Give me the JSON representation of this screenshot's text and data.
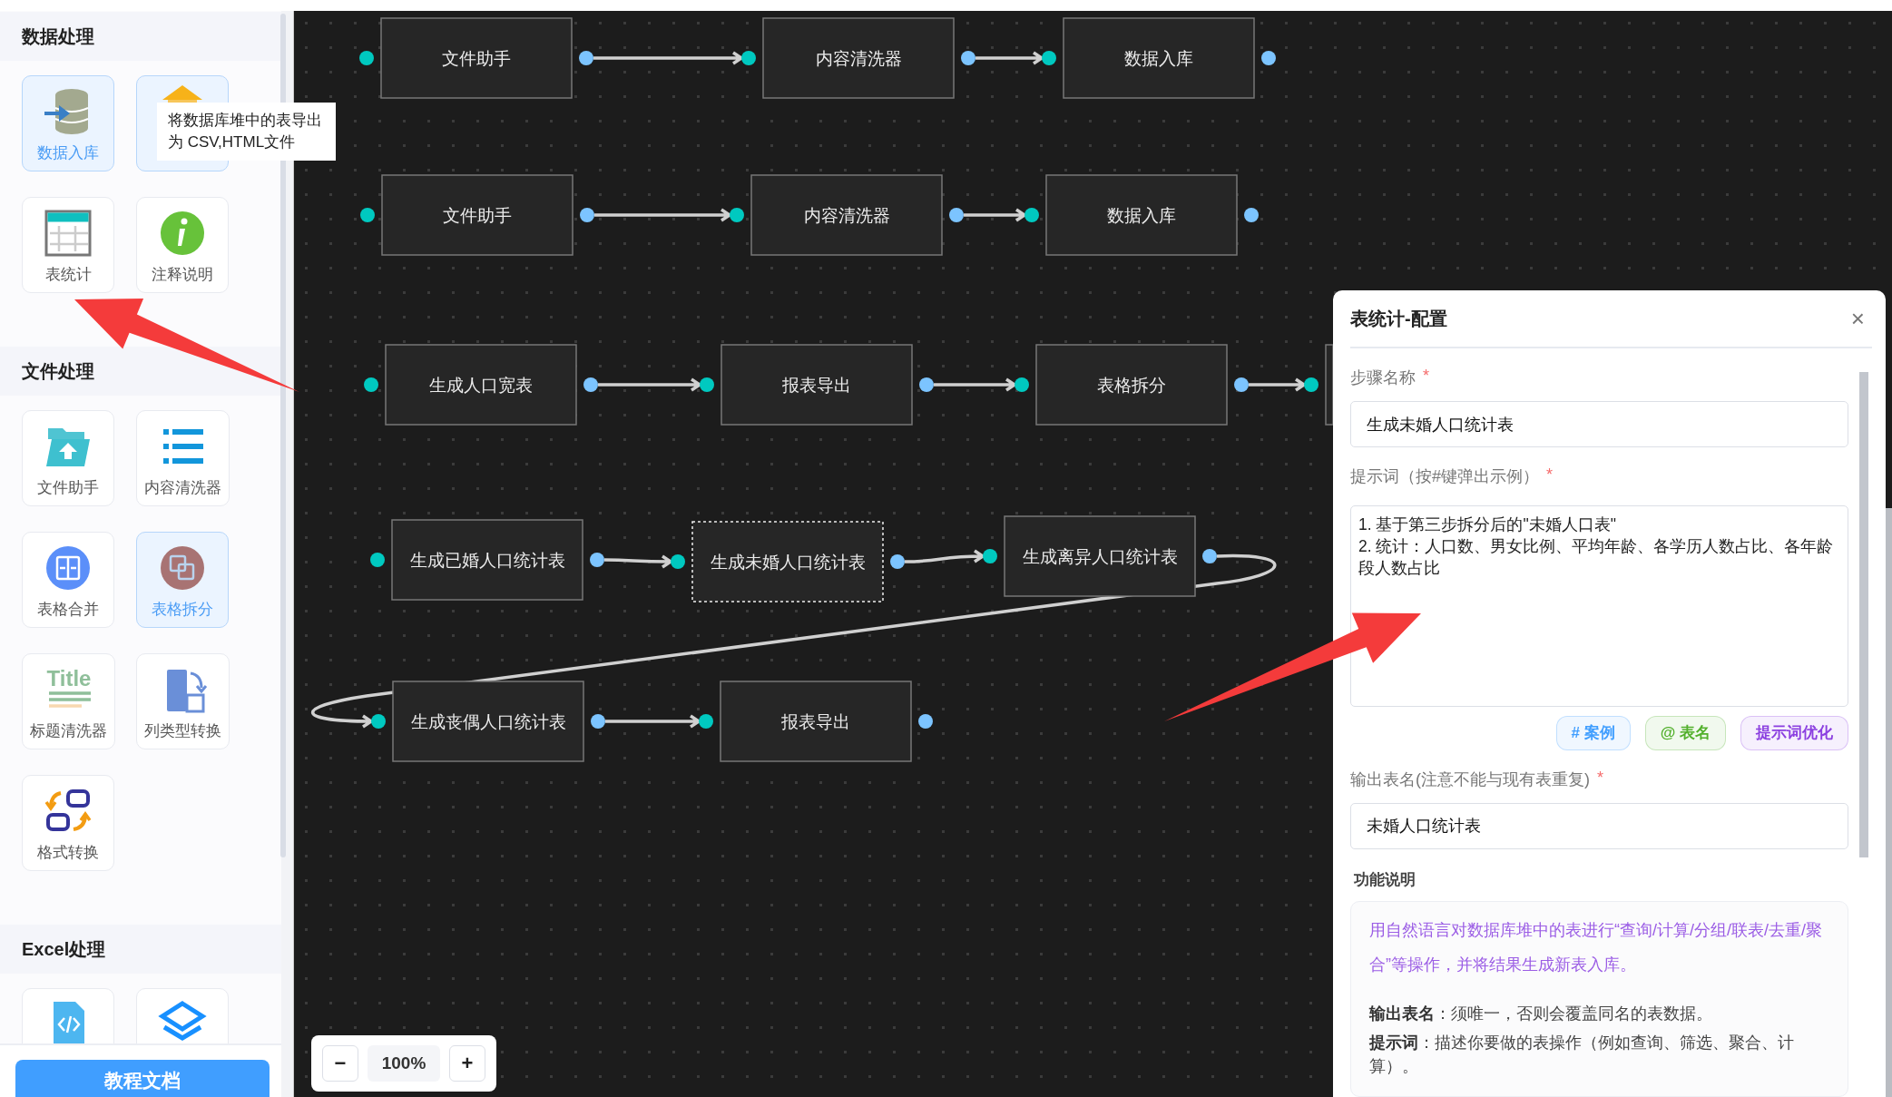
{
  "sidebar": {
    "sections": [
      {
        "title": "数据处理",
        "tiles": [
          {
            "kind": "database",
            "label": "数据入库",
            "selected": true
          },
          {
            "kind": "export",
            "selected": true
          },
          {
            "kind": "table",
            "label": "表统计",
            "selected": false
          },
          {
            "kind": "info",
            "label": "注释说明",
            "selected": false
          }
        ]
      },
      {
        "title": "文件处理",
        "tiles": [
          {
            "kind": "folder",
            "label": "文件助手",
            "selected": false
          },
          {
            "kind": "list",
            "label": "内容清洗器",
            "selected": false
          },
          {
            "kind": "merge",
            "label": "表格合并",
            "selected": false
          },
          {
            "kind": "split",
            "label": "表格拆分",
            "selected": true
          },
          {
            "kind": "title",
            "icon_text": "Title",
            "label": "标题清洗器",
            "selected": false
          },
          {
            "kind": "columns",
            "label": "列类型转换",
            "selected": false
          },
          {
            "kind": "format",
            "label": "格式转换",
            "selected": false
          }
        ]
      },
      {
        "title": "Excel处理",
        "tiles": [
          {
            "kind": "code",
            "selected": false
          },
          {
            "kind": "layers",
            "selected": false
          }
        ]
      }
    ],
    "button": "教程文档"
  },
  "tooltip": "将数据库堆中的表导出为 CSV,HTML文件",
  "canvas": {
    "rows": [
      {
        "nodes": [
          {
            "label": "文件助手",
            "selected": false
          },
          {
            "label": "内容清洗器",
            "selected": false
          },
          {
            "label": "数据入库",
            "selected": false
          }
        ]
      },
      {
        "nodes": [
          {
            "label": "文件助手",
            "selected": false
          },
          {
            "label": "内容清洗器",
            "selected": false
          },
          {
            "label": "数据入库",
            "selected": false
          }
        ]
      },
      {
        "nodes": [
          {
            "label": "生成人口宽表",
            "selected": false
          },
          {
            "label": "报表导出",
            "selected": false
          },
          {
            "label": "表格拆分",
            "selected": false
          },
          {
            "selected": false
          }
        ]
      },
      {
        "nodes": [
          {
            "label": "生成已婚人口统计表",
            "selected": false
          },
          {
            "label": "生成未婚人口统计表",
            "selected": true
          },
          {
            "label": "生成离异人口统计表",
            "selected": false
          }
        ]
      },
      {
        "nodes": [
          {
            "label": "生成丧偶人口统计表",
            "selected": false
          },
          {
            "label": "报表导出",
            "selected": false
          }
        ]
      }
    ]
  },
  "zoom": {
    "minus": "−",
    "level": "100%",
    "plus": "+"
  },
  "panel": {
    "title": "表统计-配置",
    "close": "×",
    "fields": [
      {
        "kind": "input",
        "label": "步骤名称",
        "required_mark": "*",
        "value": "生成未婚人口统计表"
      },
      {
        "kind": "textarea",
        "label": "提示词（按#键弹出示例）",
        "required_mark": "*",
        "value": "1. 基于第三步拆分后的\"未婚人口表\"\n2. 统计：人口数、男女比例、平均年龄、各学历人数占比、各年龄段人数占比"
      },
      {
        "kind": "chips",
        "chips": [
          {
            "label": "# 案例",
            "color": "#409eff"
          },
          {
            "label": "@ 表名",
            "color": "#52b02c"
          },
          {
            "label": "提示词优化",
            "color": "#8b3fe0"
          }
        ]
      },
      {
        "kind": "input",
        "label": "输出表名(注意不能与现有表重复)",
        "required_mark": "*",
        "value": "未婚人口统计表"
      }
    ],
    "help_title": "功能说明",
    "help": [
      {
        "kind": "accent",
        "text": "用自然语言对数据库堆中的表进行“查询/计算/分组/联表/去重/聚合”等操作，并将结果生成新表入库。"
      },
      {
        "kind": "plain",
        "text": "**输出表名**：须唯一，否则会覆盖同名的表数据。"
      },
      {
        "kind": "plain",
        "text": "**提示词**：描述你要做的表操作（例如查询、筛选、聚合、计算）。"
      }
    ]
  }
}
